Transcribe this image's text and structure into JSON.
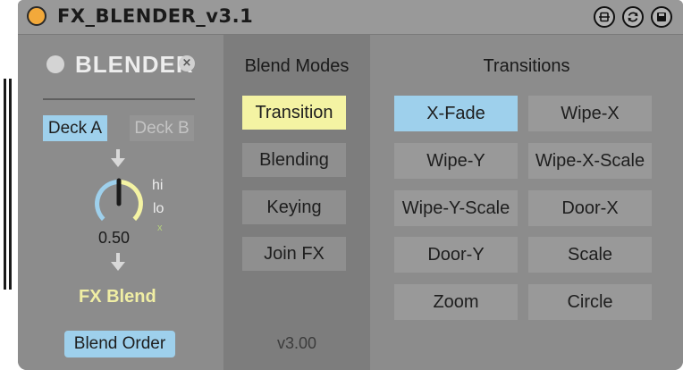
{
  "window": {
    "title": "FX_BLENDER_v3.1"
  },
  "titlebar_icons": [
    "pin-icon",
    "refresh-icon",
    "save-icon"
  ],
  "logo": {
    "text": "BLENDER"
  },
  "deck": {
    "a_label": "Deck A",
    "b_label": "Deck B",
    "selected": "Deck A"
  },
  "knob": {
    "value": "0.50",
    "hi_label": "hi",
    "lo_label": "lo",
    "x_label": "x",
    "level": 0.5
  },
  "fx_blend_label": "FX Blend",
  "blend_order_label": "Blend Order",
  "blend_modes": {
    "title": "Blend Modes",
    "items": [
      "Transition",
      "Blending",
      "Keying",
      "Join FX"
    ],
    "selected": "Transition",
    "version": "v3.00"
  },
  "transitions": {
    "title": "Transitions",
    "items": [
      "X-Fade",
      "Wipe-X",
      "Wipe-Y",
      "Wipe-X-Scale",
      "Wipe-Y-Scale",
      "Door-X",
      "Door-Y",
      "Scale",
      "Zoom",
      "Circle"
    ],
    "selected": "X-Fade"
  },
  "colors": {
    "accent_blue": "#9ed0ec",
    "accent_yellow": "#f4f3a3",
    "title_dot": "#f2a93b",
    "fx_blend_text": "#f0eea4"
  }
}
